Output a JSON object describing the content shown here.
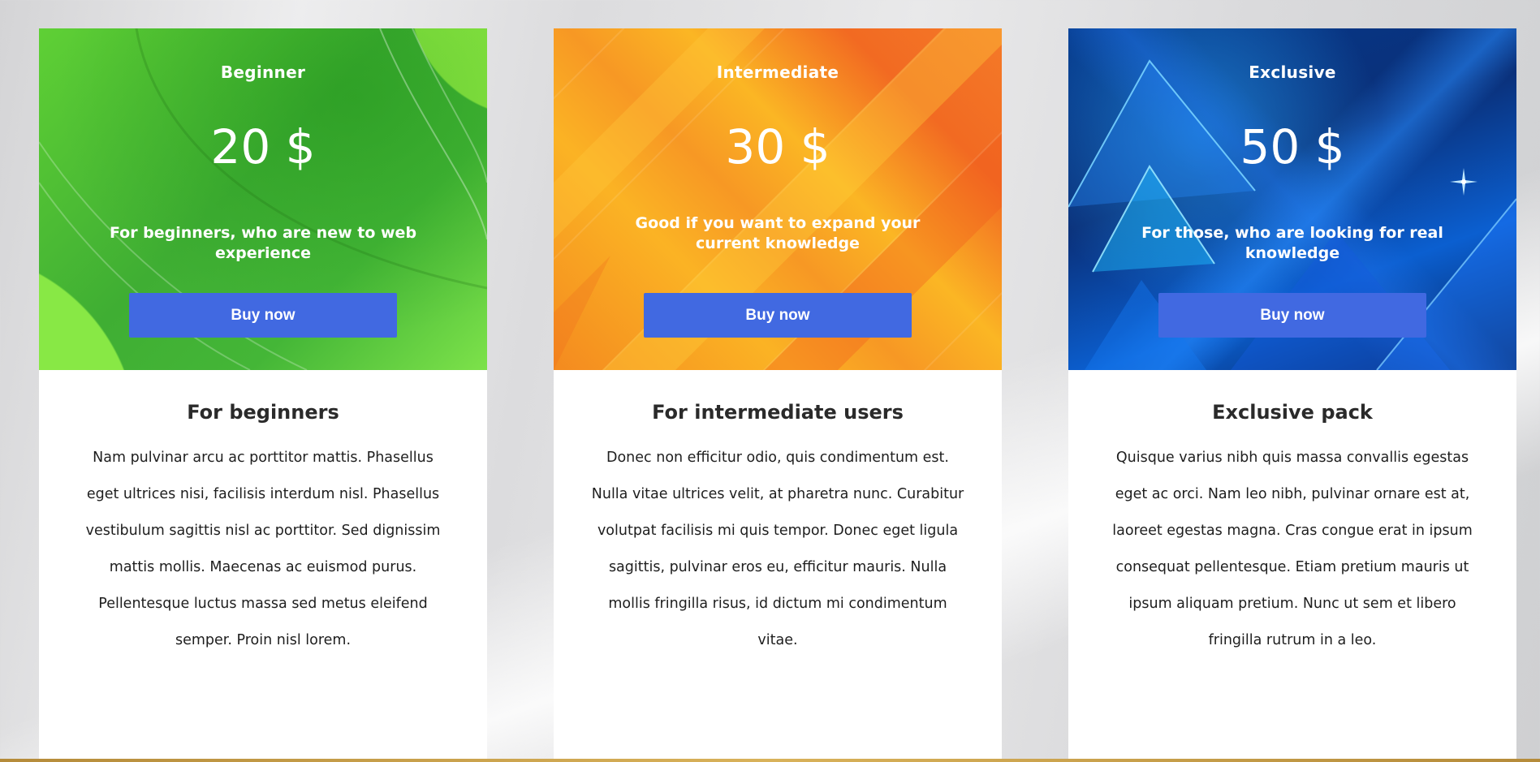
{
  "plans": [
    {
      "name": "Beginner",
      "price": "20 $",
      "tagline": "For beginners, who are new to web experience",
      "button_label": "Buy now",
      "details_title": "For beginners",
      "details_text": "Nam pulvinar arcu ac porttitor mattis. Phasellus eget ultrices nisi, facilisis interdum nisl. Phasellus vestibulum sagittis nisl ac porttitor. Sed dignissim mattis mollis. Maecenas ac euismod purus. Pellentesque luctus massa sed metus eleifend semper. Proin nisl lorem."
    },
    {
      "name": "Intermediate",
      "price": "30 $",
      "tagline": "Good if you want to expand your current knowledge",
      "button_label": "Buy now",
      "details_title": "For intermediate users",
      "details_text": "Donec non efficitur odio, quis condimentum est. Nulla vitae ultrices velit, at pharetra nunc. Curabitur volutpat facilisis mi quis tempor. Donec eget ligula sagittis, pulvinar eros eu, efficitur mauris. Nulla mollis fringilla risus, id dictum mi condimentum vitae."
    },
    {
      "name": "Exclusive",
      "price": "50 $",
      "tagline": "For those, who are looking for real knowledge",
      "button_label": "Buy now",
      "details_title": "Exclusive pack",
      "details_text": "Quisque varius nibh quis massa convallis egestas eget ac orci. Nam leo nibh, pulvinar ornare est at, laoreet egestas magna. Cras congue erat in ipsum consequat pellentesque. Etiam pretium mauris ut ipsum aliquam pretium. Nunc ut sem et libero fringilla rutrum in a leo."
    }
  ],
  "colors": {
    "button": "#4169e1",
    "beginner_theme": "#3fae33",
    "intermediate_theme": "#f79824",
    "exclusive_theme": "#0a2f78"
  }
}
